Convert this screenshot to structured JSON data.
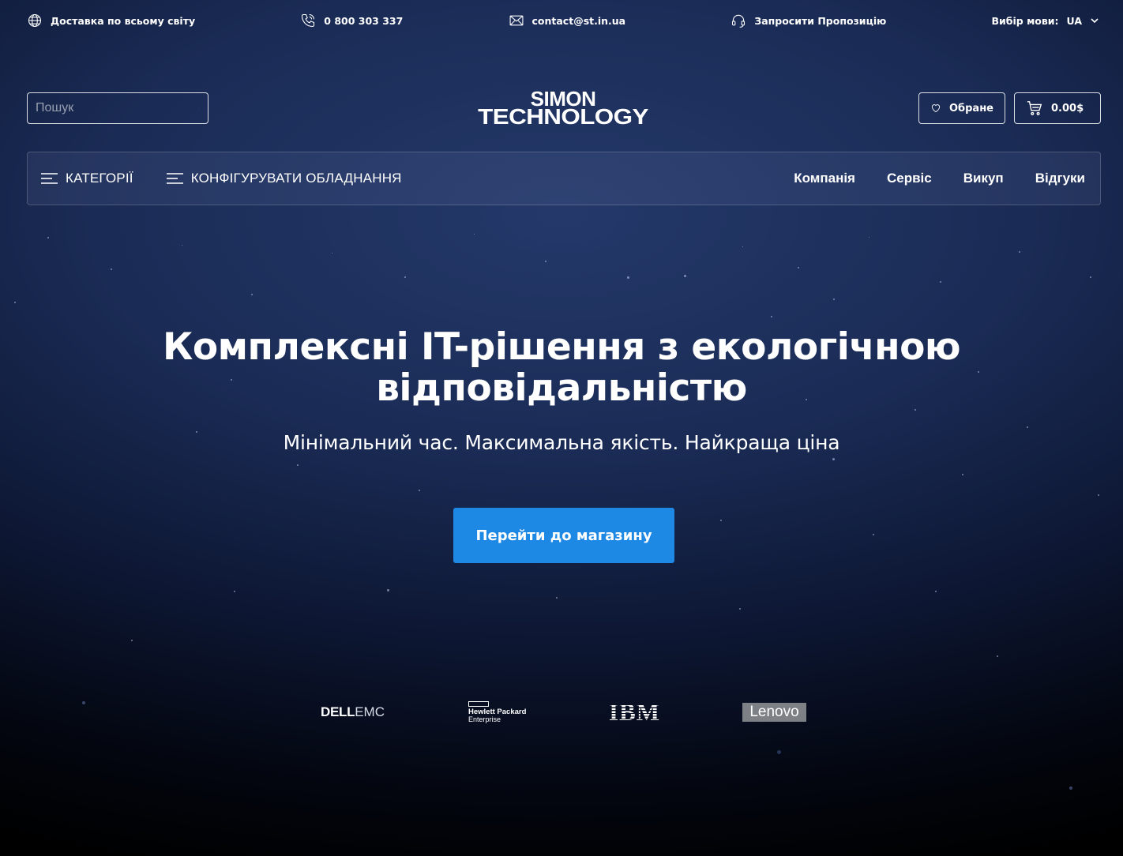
{
  "topbar": {
    "delivery": "Доставка по всьому світу",
    "phone": "0 800 303 337",
    "email": "contact@st.in.ua",
    "request": "Запросити Пропозицію",
    "lang_label": "Вибір мови:",
    "lang_value": "UA",
    "icons": [
      "globe-icon",
      "phone-icon",
      "mail-icon",
      "headset-icon",
      "chevron-down-icon"
    ]
  },
  "header": {
    "search_placeholder": "Пошук",
    "logo_line1": "SIMON",
    "logo_line2": "TECHNOLOGY",
    "favorites_label": "Обране",
    "cart_total": "0.00$"
  },
  "nav": {
    "categories": "КАТЕГОРІЇ",
    "configure": "КОНФІГУРУВАТИ ОБЛАДНАННЯ",
    "links": [
      "Компанія",
      "Сервіс",
      "Викуп",
      "Відгуки"
    ]
  },
  "hero": {
    "title_line1": "Комплексні IT-рішення з екологічною",
    "title_line2": "відповідальністю",
    "subtitle": "Мінімальний час. Максимальна якість. Найкраща ціна",
    "cta": "Перейти до магазину"
  },
  "brands": {
    "dell": "DELL",
    "emc": "EMC",
    "hpe_line1": "Hewlett Packard",
    "hpe_line2": "Enterprise",
    "ibm": "IBM",
    "lenovo": "Lenovo"
  },
  "colors": {
    "accent": "#1e88e5",
    "background_top": "#24396a",
    "background_bottom": "#000000"
  }
}
